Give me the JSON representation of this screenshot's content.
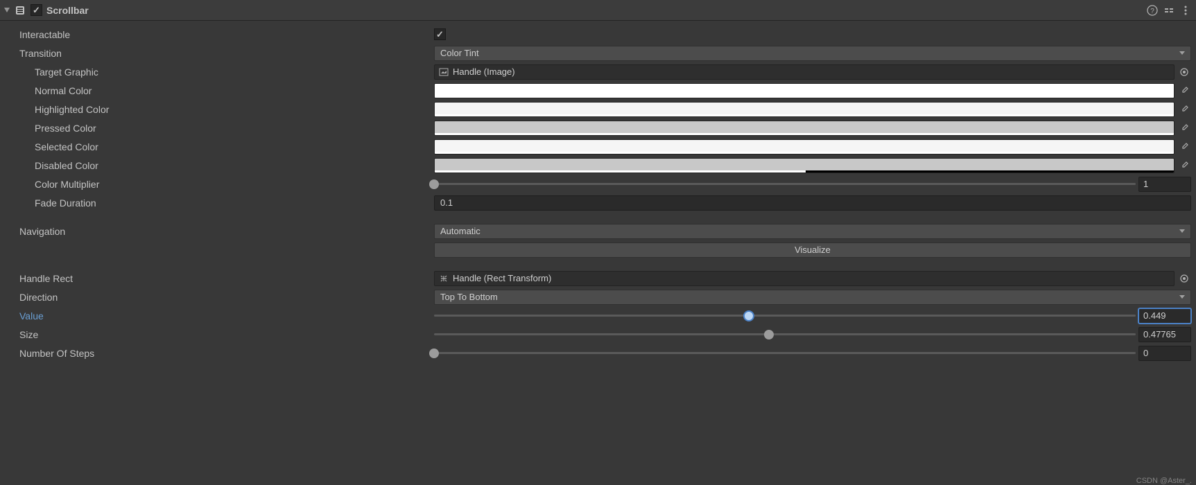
{
  "header": {
    "title": "Scrollbar",
    "enabled": true
  },
  "props": {
    "interactable": {
      "label": "Interactable",
      "value": true
    },
    "transition": {
      "label": "Transition",
      "value": "Color Tint"
    },
    "targetGraphic": {
      "label": "Target Graphic",
      "value": "Handle (Image)"
    },
    "normalColor": {
      "label": "Normal Color",
      "color": "#ffffff",
      "alpha": 1.0
    },
    "highlightedColor": {
      "label": "Highlighted Color",
      "color": "#f5f5f5",
      "alpha": 1.0
    },
    "pressedColor": {
      "label": "Pressed Color",
      "color": "#c8c8c8",
      "alpha": 1.0
    },
    "selectedColor": {
      "label": "Selected Color",
      "color": "#f5f5f5",
      "alpha": 1.0
    },
    "disabledColor": {
      "label": "Disabled Color",
      "color": "#c8c8c8",
      "alpha": 0.502
    },
    "colorMultiplier": {
      "label": "Color Multiplier",
      "value": "1",
      "sliderPos": 0.0
    },
    "fadeDuration": {
      "label": "Fade Duration",
      "value": "0.1"
    },
    "navigation": {
      "label": "Navigation",
      "value": "Automatic"
    },
    "visualizeButton": "Visualize",
    "handleRect": {
      "label": "Handle Rect",
      "value": "Handle (Rect Transform)"
    },
    "direction": {
      "label": "Direction",
      "value": "Top To Bottom"
    },
    "valueProp": {
      "label": "Value",
      "value": "0.449",
      "sliderPos": 0.449
    },
    "size": {
      "label": "Size",
      "value": "0.47765",
      "sliderPos": 0.47765
    },
    "numberOfSteps": {
      "label": "Number Of Steps",
      "value": "0",
      "sliderPos": 0.0
    }
  },
  "watermark": "CSDN @Aster_."
}
